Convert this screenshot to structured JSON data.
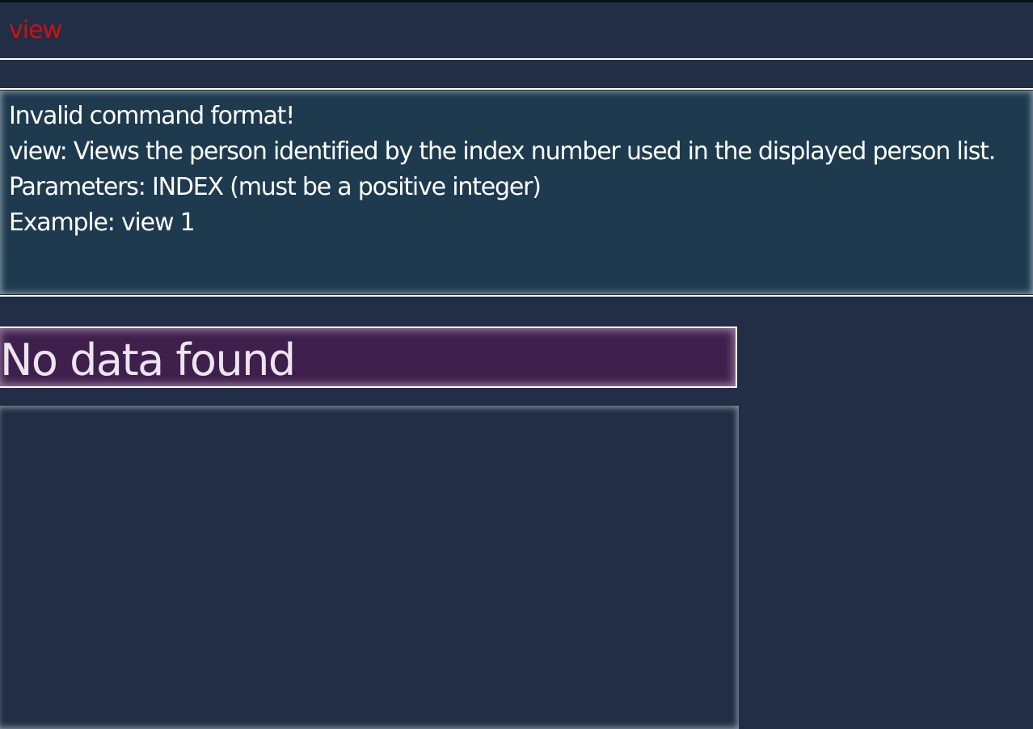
{
  "command_box": {
    "value": "view",
    "text_color": "#d01010"
  },
  "result_display": {
    "lines": [
      "Invalid command format!",
      "view: Views the person identified by the index number used in the displayed person list.",
      "Parameters: INDEX (must be a positive integer)",
      "Example: view 1"
    ]
  },
  "person_panel": {
    "empty_message": "No data found"
  },
  "colors": {
    "background": "#212e45",
    "result_bg": "#1e3a4e",
    "empty_banner_bg": "#3f1f4b",
    "error": "#d01010"
  }
}
